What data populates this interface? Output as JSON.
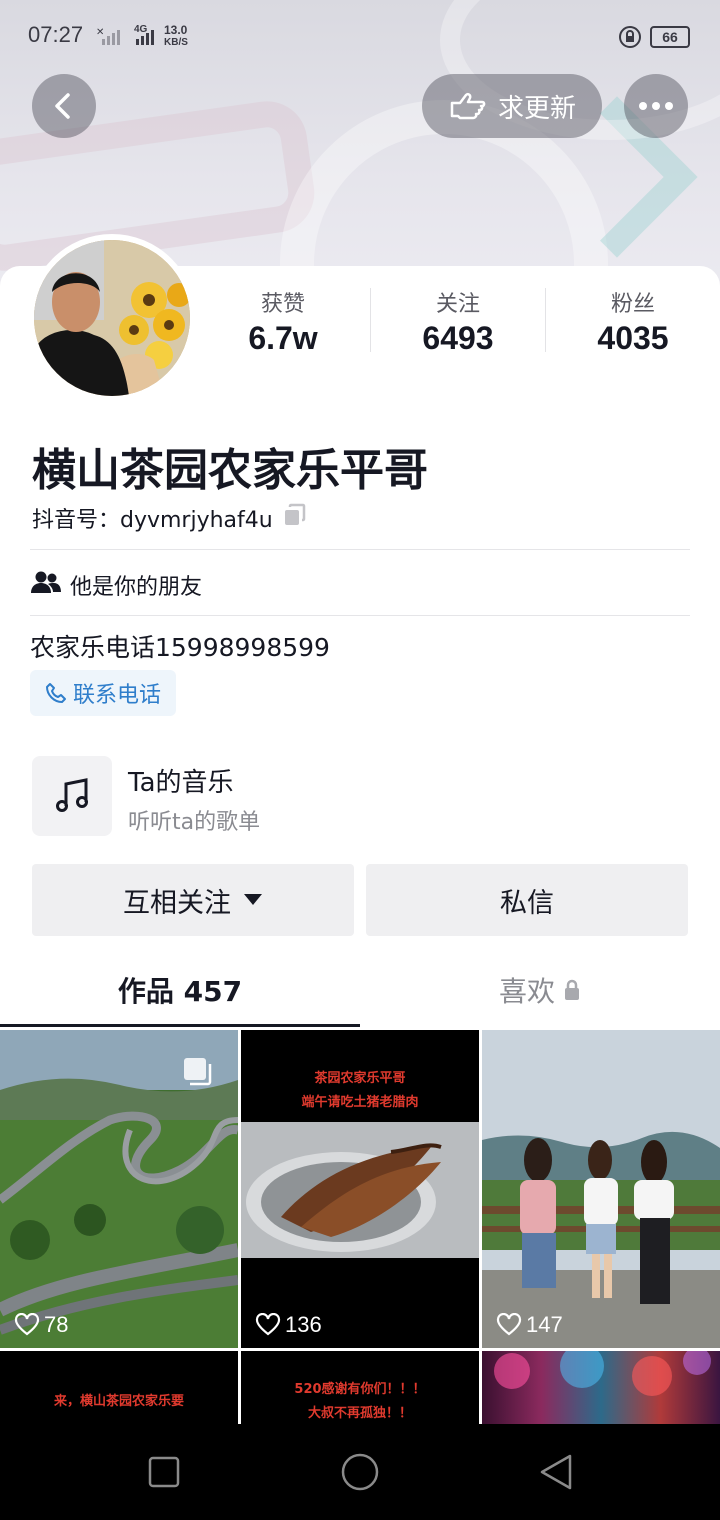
{
  "status_bar": {
    "time": "07:27",
    "network_type": "4G",
    "speed_value": "13.0",
    "speed_unit": "KB/S",
    "battery": "66"
  },
  "header": {
    "update_label": "求更新"
  },
  "stats": [
    {
      "label": "获赞",
      "value": "6.7w"
    },
    {
      "label": "关注",
      "value": "6493"
    },
    {
      "label": "粉丝",
      "value": "4035"
    }
  ],
  "profile": {
    "name": "横山茶园农家乐平哥",
    "douyin_id": "抖音号：dyvmrjyhaf4u",
    "friend_text": "他是你的朋友",
    "bio": "农家乐电话15998998599",
    "contact_label": "联系电话"
  },
  "music": {
    "title": "Ta的音乐",
    "subtitle": "听听ta的歌单"
  },
  "actions": {
    "follow_label": "互相关注",
    "message_label": "私信"
  },
  "tabs": {
    "works_label": "作品 457",
    "likes_label": "喜欢"
  },
  "grid": [
    {
      "likes": "78"
    },
    {
      "likes": "136",
      "caption_line1": "茶园农家乐平哥",
      "caption_line2": "端午请吃土猪老腊肉"
    },
    {
      "likes": "147"
    },
    {
      "caption_line1": "来，横山茶园农家乐要"
    },
    {
      "caption_line1": "520感谢有你们！！！",
      "caption_line2": "大叔不再孤独！！"
    },
    {}
  ],
  "colors": {
    "accent_blue": "#2f7ecb",
    "text_primary": "#161823",
    "button_gray": "#efeff1"
  }
}
